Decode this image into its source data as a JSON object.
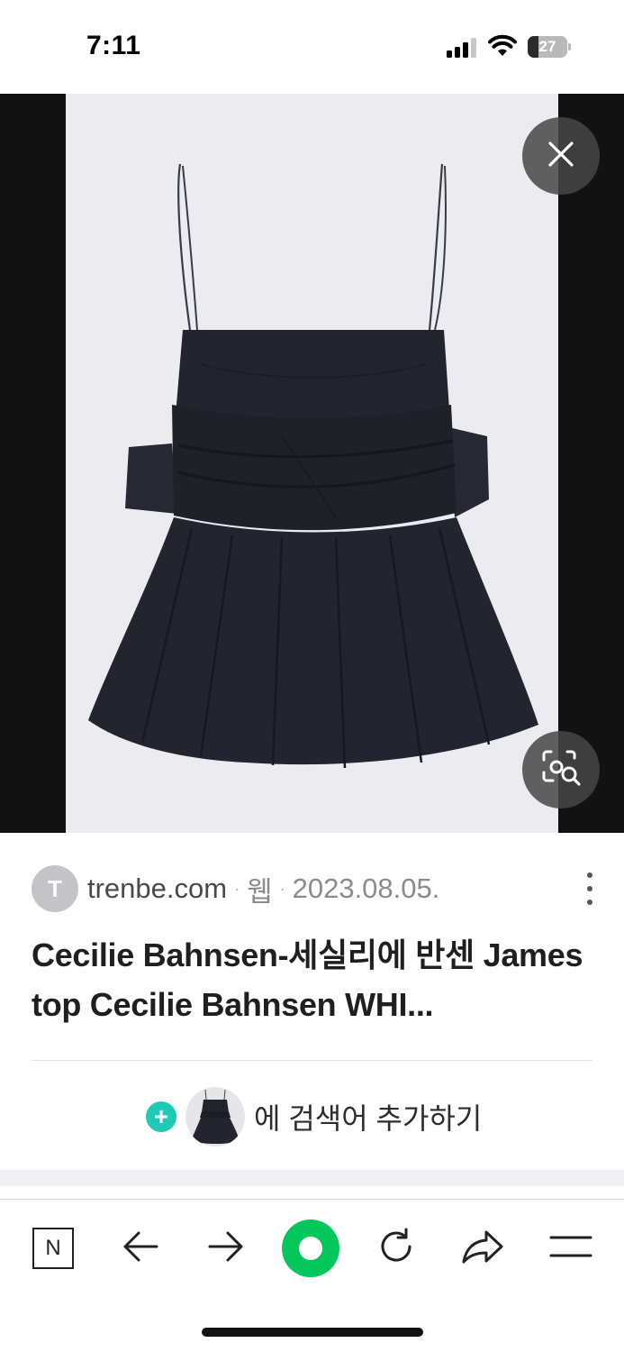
{
  "status_bar": {
    "time": "7:11",
    "battery_level": "27",
    "icons": [
      "cellular-signal-icon",
      "wifi-icon",
      "battery-icon"
    ]
  },
  "viewer": {
    "image_subject": "navy strapless peplum top with bow",
    "close_icon": "close-icon",
    "lens_icon": "image-search-icon"
  },
  "result": {
    "favicon_letter": "T",
    "domain": "trenbe.com",
    "separator": "·",
    "category": "웹",
    "date": "2023.08.05.",
    "title": "Cecilie Bahnsen-세실리에 반센 James top Cecilie Bahnsen WHI...",
    "add_search_text": "에 검색어 추가하기",
    "plus": "+"
  },
  "toolbar": {
    "items": [
      "naver-home-icon",
      "back-arrow-icon",
      "forward-arrow-icon",
      "green-dot-icon",
      "refresh-icon",
      "share-icon",
      "menu-icon"
    ],
    "home_letter": "N"
  },
  "colors": {
    "accent_green": "#03c75a",
    "plus_teal": "#1fc9b7",
    "garment": "#22242e",
    "photo_bg": "#ececf0"
  }
}
